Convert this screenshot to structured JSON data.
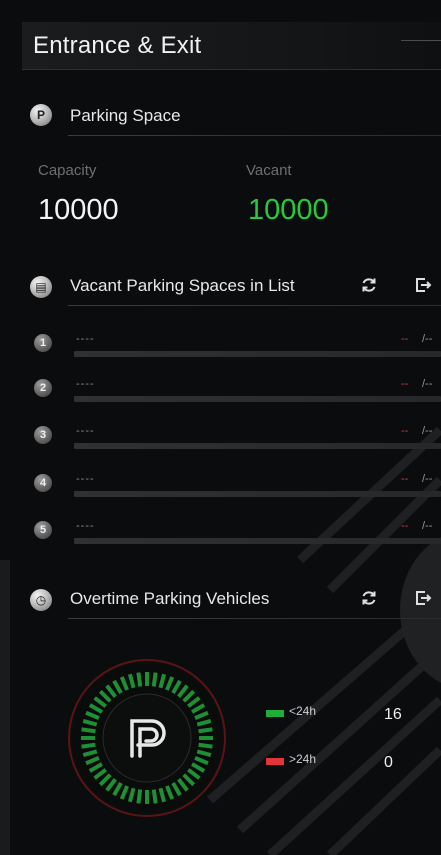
{
  "header": {
    "title": "Entrance & Exit"
  },
  "parking_space": {
    "title": "Parking Space",
    "capacity_label": "Capacity",
    "capacity_value": "10000",
    "vacant_label": "Vacant",
    "vacant_value": "10000"
  },
  "vacant_list": {
    "title": "Vacant Parking Spaces in List",
    "rows": [
      {
        "index": "1",
        "name": "----",
        "value": "--",
        "total": "/--",
        "fill": 0
      },
      {
        "index": "2",
        "name": "----",
        "value": "--",
        "total": "/--",
        "fill": 0
      },
      {
        "index": "3",
        "name": "----",
        "value": "--",
        "total": "/--",
        "fill": 0
      },
      {
        "index": "4",
        "name": "----",
        "value": "--",
        "total": "/--",
        "fill": 0
      },
      {
        "index": "5",
        "name": "----",
        "value": "--",
        "total": "/--",
        "fill": 0
      }
    ]
  },
  "overtime": {
    "title": "Overtime Parking Vehicles",
    "legend": [
      {
        "label": "<24h",
        "count": "16",
        "color": "#1fae3a"
      },
      {
        "label": ">24h",
        "count": "0",
        "color": "#e0353a"
      }
    ]
  },
  "colors": {
    "vacant": "#26c93f",
    "accent_red": "#e03a3a",
    "gauge_green": "#1f8f35"
  },
  "icons": {
    "refresh": "refresh-icon",
    "export": "export-icon",
    "parking": "parking-p-icon"
  }
}
